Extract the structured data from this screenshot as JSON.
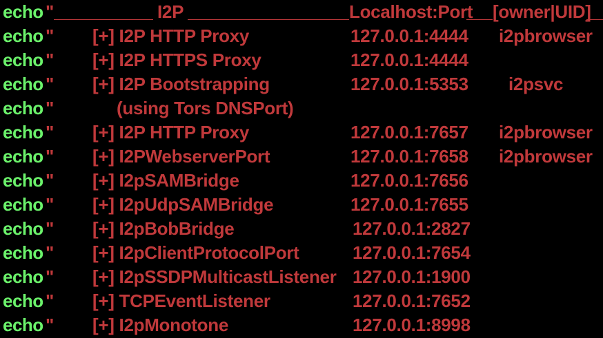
{
  "terminal": {
    "header": {
      "echo": "echo",
      "quote": "\"",
      "title": "I2P",
      "localhost_port": "Localhost:Port",
      "owner_uid": "[owner|UID]"
    },
    "rows": [
      {
        "echo": "echo",
        "quote": "\"",
        "service": "[+] I2P HTTP Proxy",
        "port": "127.0.0.1:4444",
        "owner": "i2pbrowser"
      },
      {
        "echo": "echo",
        "quote": "\"",
        "service": "[+] I2P HTTPS Proxy",
        "port": "127.0.0.1:4444",
        "owner": ""
      },
      {
        "echo": "echo",
        "quote": "\"",
        "service": "[+] I2P Bootstrapping",
        "port": "127.0.0.1:5353",
        "owner": "i2psvc"
      },
      {
        "echo": "echo",
        "quote": "\"",
        "service": "(using Tors DNSPort)",
        "port": "",
        "owner": ""
      },
      {
        "echo": "echo",
        "quote": "\"",
        "service": "[+] I2P HTTP Proxy",
        "port": "127.0.0.1:7657",
        "owner": "i2pbrowser"
      },
      {
        "echo": "echo",
        "quote": "\"",
        "service": "[+] I2PWebserverPort",
        "port": "127.0.0.1:7658",
        "owner": "i2pbrowser"
      },
      {
        "echo": "echo",
        "quote": "\"",
        "service": "[+] I2pSAMBridge",
        "port": "127.0.0.1:7656",
        "owner": ""
      },
      {
        "echo": "echo",
        "quote": "\"",
        "service": "[+] I2pUdpSAMBridge",
        "port": "127.0.0.1:7655",
        "owner": ""
      },
      {
        "echo": "echo",
        "quote": "\"",
        "service": "[+] I2pBobBridge",
        "port": "127.0.0.1:2827",
        "owner": ""
      },
      {
        "echo": "echo",
        "quote": "\"",
        "service": "[+] I2pClientProtocolPort",
        "port": "127.0.0.1:7654",
        "owner": ""
      },
      {
        "echo": "echo",
        "quote": "\"",
        "service": "[+] I2pSSDPMulticastListener",
        "port": "127.0.0.1:1900",
        "owner": ""
      },
      {
        "echo": "echo",
        "quote": "\"",
        "service": "[+] TCPEventListener",
        "port": "127.0.0.1:7652",
        "owner": ""
      },
      {
        "echo": "echo",
        "quote": "\"",
        "service": "[+] I2pMonotone",
        "port": "127.0.0.1:8998",
        "owner": ""
      }
    ]
  },
  "colors": {
    "background": "#000000",
    "keyword": "#6bf26b",
    "string": "#c0393b"
  }
}
